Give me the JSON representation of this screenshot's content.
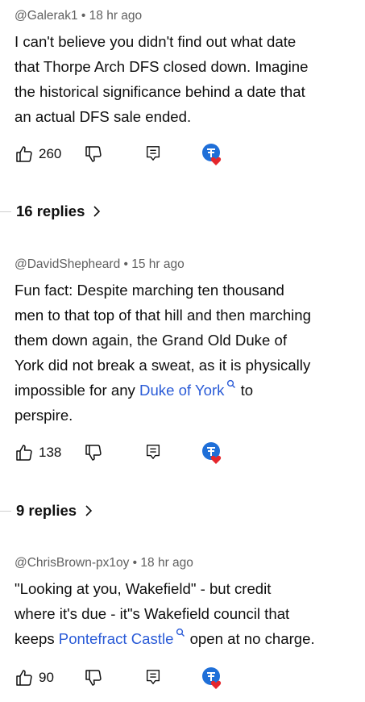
{
  "comments": [
    {
      "meta": "@Galerak1 • 18 hr ago",
      "lines": [
        "I can't believe you didn't find out what date",
        "that Thorpe Arch DFS closed down. Imagine",
        "the historical significance behind a date that",
        "an actual DFS sale ended."
      ],
      "likes": "260",
      "replies": "16 replies"
    },
    {
      "meta": "@DavidShepheard • 15 hr ago",
      "lines": [
        "Fun fact: Despite marching ten thousand",
        "men to that top of that hill and then marching",
        "them down again, the Grand Old Duke of",
        "York did not break a sweat, as it is physically"
      ],
      "line5_pre": "impossible for any ",
      "line5_link": "Duke of York",
      "line5_post": " to",
      "line6": "perspire.",
      "likes": "138",
      "replies": "9 replies"
    },
    {
      "meta": "@ChrisBrown-px1oy • 18 hr ago",
      "lines": [
        "\"Looking at you, Wakefield\" - but credit",
        "where it's due - it\"s Wakefield council that"
      ],
      "line3_pre": "keeps ",
      "line3_link": "Pontefract Castle",
      "line3_post": " open at no charge.",
      "likes": "90"
    }
  ],
  "colors": {
    "link": "#2a5bd7",
    "heart": "#e5262c",
    "avatar": "#1f6fd8"
  },
  "icons": [
    "thumbs-up-icon",
    "thumbs-down-icon",
    "reply-icon",
    "creator-heart-icon",
    "chevron-right-icon",
    "search-icon"
  ]
}
